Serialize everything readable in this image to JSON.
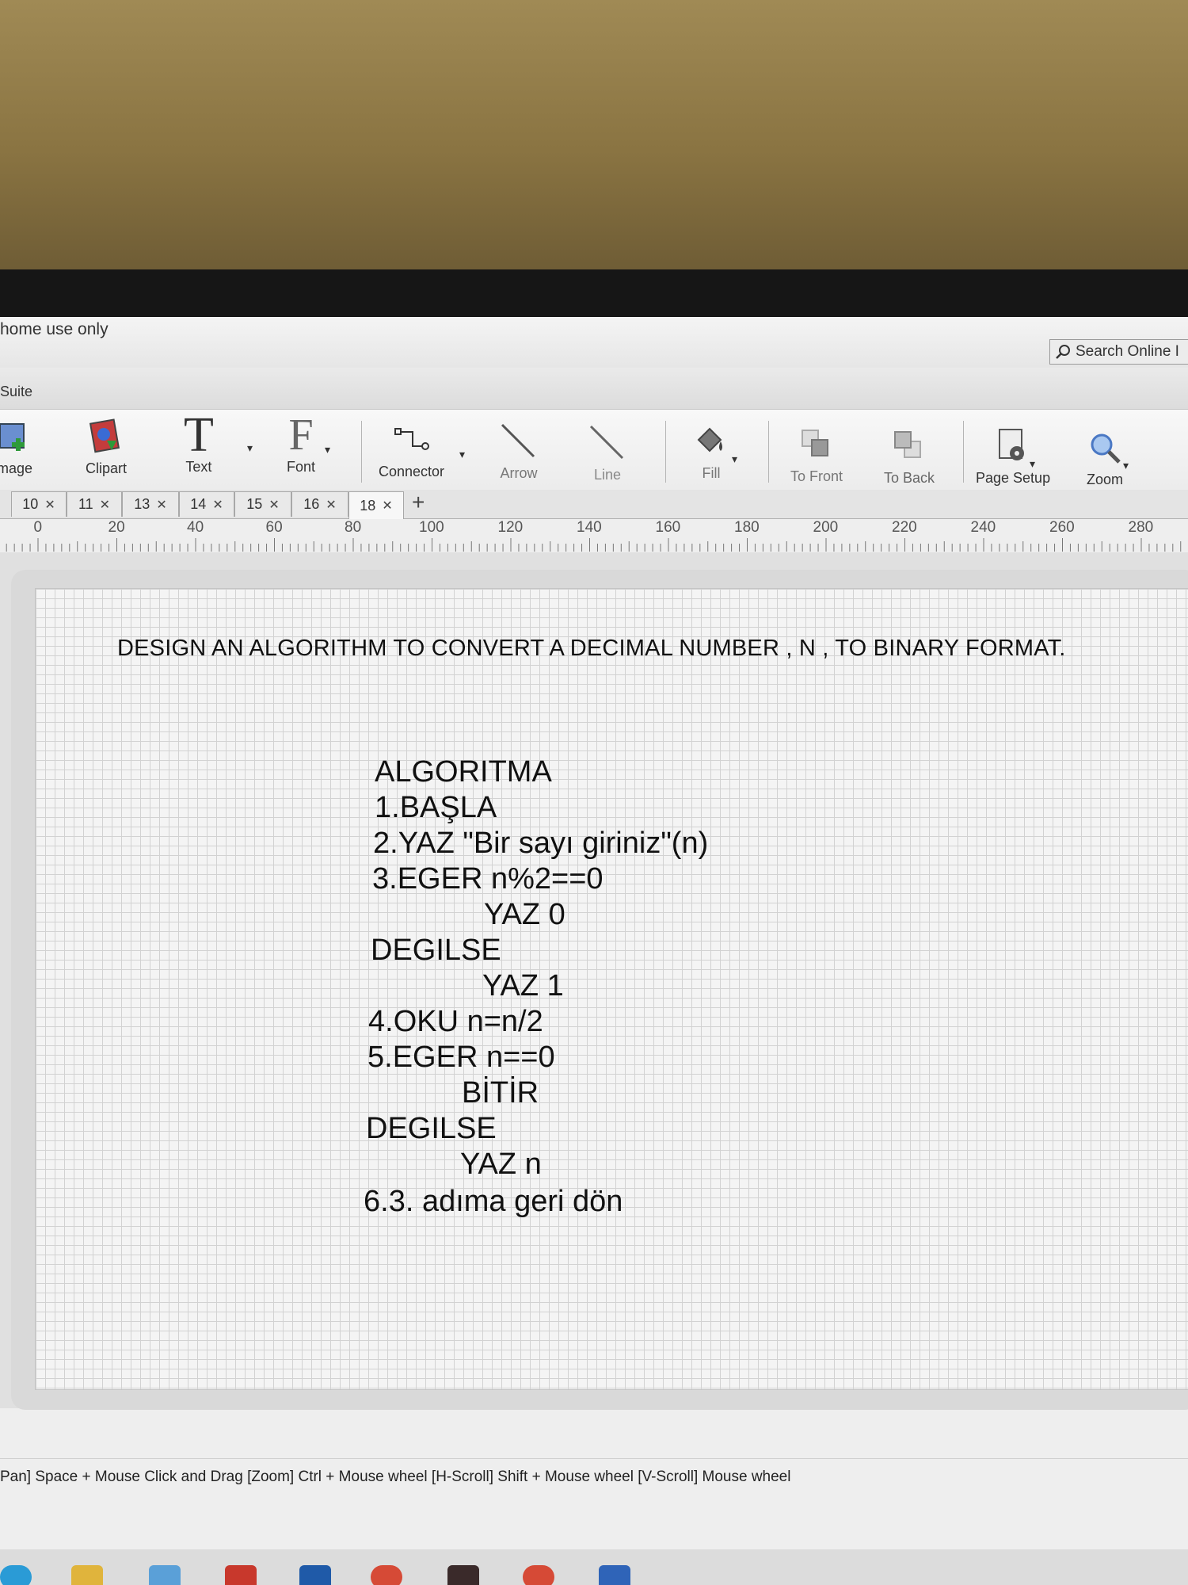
{
  "window": {
    "title": "home use only",
    "search_placeholder": "Search Online I",
    "suite_label": "Suite"
  },
  "toolbar": {
    "items": [
      {
        "label": "mage",
        "icon": "image-icon"
      },
      {
        "label": "Clipart",
        "icon": "clipart-icon"
      },
      {
        "label": "Text",
        "icon": "text-icon"
      },
      {
        "label": "Font",
        "icon": "font-icon"
      },
      {
        "label": "Connector",
        "icon": "connector-icon"
      },
      {
        "label": "Arrow",
        "icon": "arrow-icon"
      },
      {
        "label": "Line",
        "icon": "line-icon"
      },
      {
        "label": "Fill",
        "icon": "fill-icon"
      },
      {
        "label": "To Front",
        "icon": "to-front-icon"
      },
      {
        "label": "To Back",
        "icon": "to-back-icon"
      },
      {
        "label": "Page Setup",
        "icon": "page-setup-icon"
      },
      {
        "label": "Zoom",
        "icon": "zoom-icon"
      }
    ]
  },
  "tabs": [
    {
      "label": "10"
    },
    {
      "label": "11"
    },
    {
      "label": "13"
    },
    {
      "label": "14"
    },
    {
      "label": "15"
    },
    {
      "label": "16"
    },
    {
      "label": "18",
      "active": true
    }
  ],
  "ruler": [
    "0",
    "20",
    "40",
    "60",
    "80",
    "100",
    "120",
    "140",
    "160",
    "180",
    "200",
    "220",
    "240",
    "260",
    "280"
  ],
  "document": {
    "heading": "DESIGN AN ALGORITHM TO CONVERT A DECIMAL NUMBER , N , TO BINARY FORMAT.",
    "algorithm": [
      "ALGORITMA",
      "1.BAŞLA",
      "2.YAZ \"Bir sayı giriniz\"(n)",
      "3.EGER n%2==0",
      "YAZ 0",
      "DEGILSE",
      "YAZ 1",
      "4.OKU n=n/2",
      "5.EGER n==0",
      "BİTİR",
      "DEGILSE",
      "YAZ n",
      "6.3. adıma geri dön"
    ]
  },
  "status": {
    "hint": "Pan] Space + Mouse Click and Drag  [Zoom] Ctrl + Mouse wheel  [H-Scroll] Shift + Mouse wheel  [V-Scroll] Mouse wheel"
  },
  "colors": {
    "wall": "#8a7442",
    "bezel": "#161616",
    "canvas": "#f4f4f4",
    "grid": "#d2d2d2"
  }
}
